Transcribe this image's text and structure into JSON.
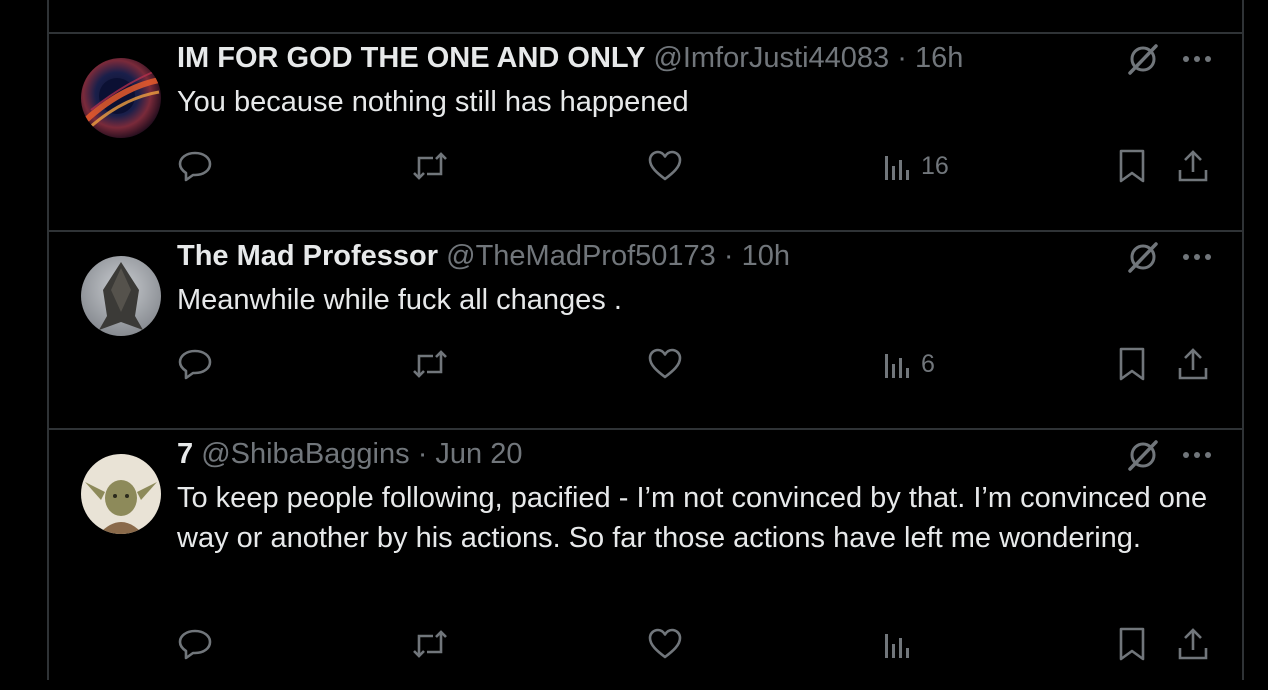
{
  "tweets": [
    {
      "name": "IM FOR GOD THE ONE AND ONLY",
      "handle": "@ImforJusti44083",
      "sep": "·",
      "time": "16h",
      "text": "You because nothing still has happened",
      "views": "16",
      "avatar": "avatar-galaxy"
    },
    {
      "name": "The Mad Professor",
      "handle": "@TheMadProf50173",
      "sep": "·",
      "time": "10h",
      "text": "Meanwhile while fuck all changes .",
      "views": "6",
      "avatar": "avatar-arrowhead"
    },
    {
      "name": "7",
      "handle": "@ShibaBaggins",
      "sep": "·",
      "time": "Jun 20",
      "text": "To keep people following, pacified - I’m not convinced by that. I’m convinced one way or another by his actions. So far those actions have left me wondering.",
      "avatar": "avatar-yoda"
    }
  ],
  "icons": [
    "reply-icon",
    "retweet-icon",
    "like-icon",
    "views-icon",
    "bookmark-icon",
    "share-icon",
    "grok-icon",
    "more-icon"
  ],
  "colors": {
    "background": "#000000",
    "text": "#e7e9ea",
    "muted": "#71767b",
    "border": "#2f3336"
  }
}
